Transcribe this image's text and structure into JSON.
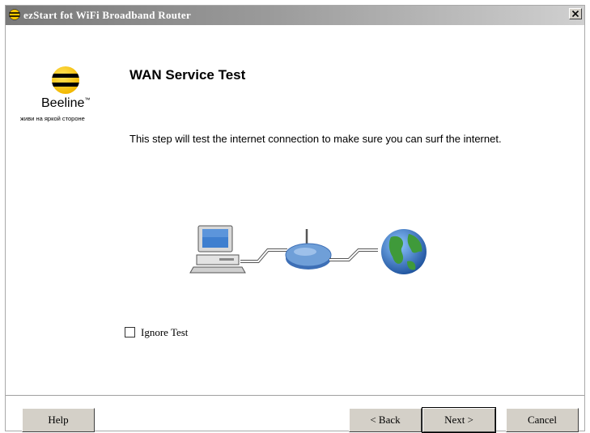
{
  "window": {
    "title": "ezStart fot WiFi Broadband Router",
    "close_label": "x"
  },
  "logo": {
    "brand": "Beeline",
    "trademark": "™",
    "tagline": "живи на яркой стороне"
  },
  "page": {
    "title": "WAN Service Test",
    "description": "This step will test the internet connection to make sure you can surf the internet."
  },
  "options": {
    "ignore_test_label": "Ignore Test",
    "ignore_test_checked": false
  },
  "buttons": {
    "help": "Help",
    "back": "< Back",
    "next": "Next >",
    "cancel": "Cancel"
  },
  "colors": {
    "brand_yellow": "#f7c600",
    "globe_blue": "#2a77c9",
    "router_blue": "#6f9fd8"
  }
}
